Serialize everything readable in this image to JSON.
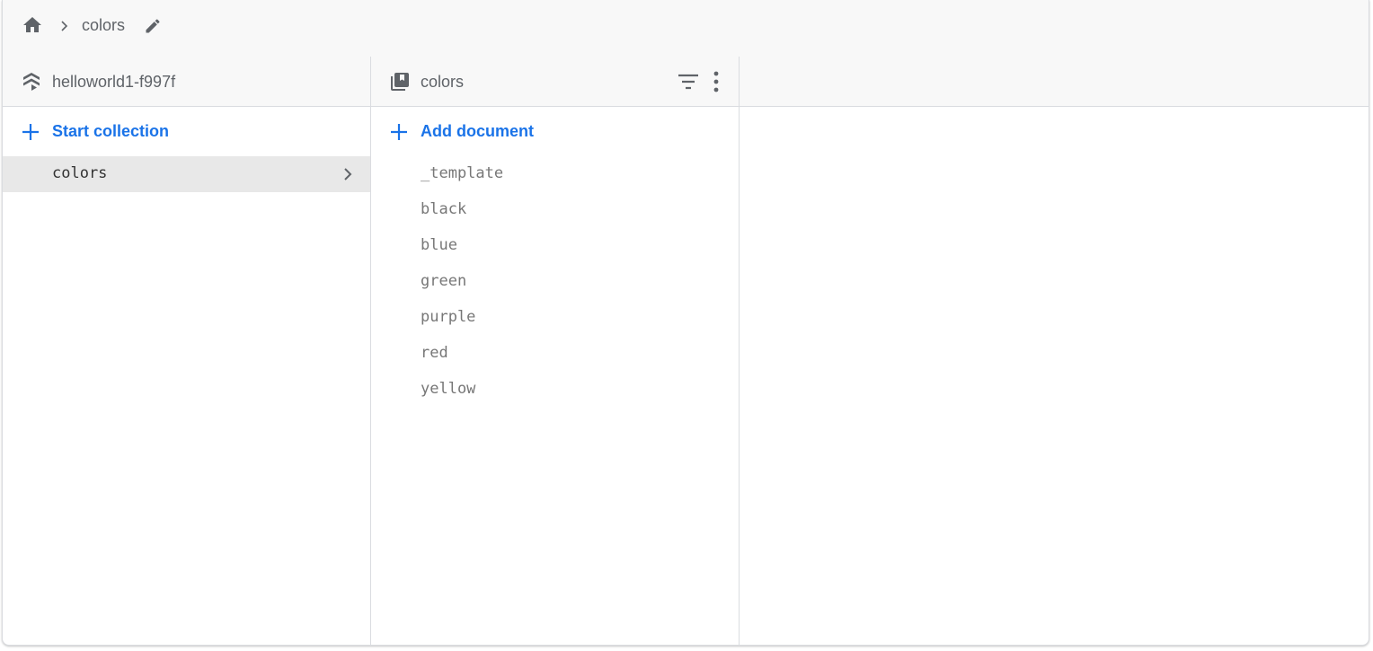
{
  "breadcrumb": {
    "home_icon": "home-icon",
    "separator_icon": "chevron-right-icon",
    "current": "colors",
    "edit_icon": "edit-pencil-icon"
  },
  "root_panel": {
    "icon": "firestore-layers-icon",
    "title": "helloworld1-f997f",
    "add_label": "Start collection",
    "items": [
      {
        "label": "colors",
        "selected": true
      }
    ]
  },
  "collection_panel": {
    "icon": "collection-icon",
    "title": "colors",
    "filter_icon": "filter-icon",
    "more_icon": "more-vert-icon",
    "add_label": "Add document",
    "documents": [
      {
        "label": "_template"
      },
      {
        "label": "black"
      },
      {
        "label": "blue"
      },
      {
        "label": "green"
      },
      {
        "label": "purple"
      },
      {
        "label": "red"
      },
      {
        "label": "yellow"
      }
    ]
  },
  "colors": {
    "accent": "#1a73e8",
    "text_muted": "#5f6368",
    "header_bg": "#f8f8f8",
    "selected_bg": "#e8e8e8",
    "border": "#dadce0"
  }
}
